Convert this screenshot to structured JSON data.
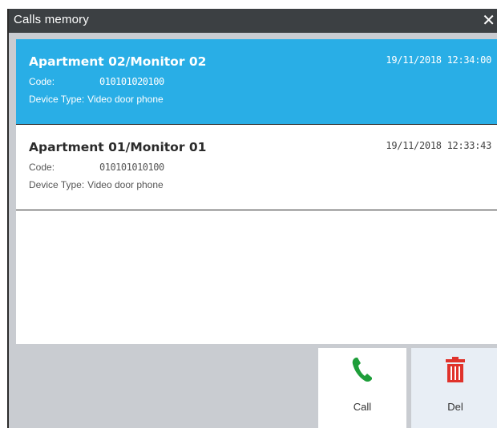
{
  "window": {
    "title": "Calls memory",
    "close_glyph": "✕"
  },
  "calls": [
    {
      "name": "Apartment 02/Monitor 02",
      "datetime": "19/11/2018 12:34:00",
      "code_label": "Code:",
      "code": "010101020100",
      "device_type_label": "Device Type:",
      "device_type": "Video door phone",
      "selected": true
    },
    {
      "name": "Apartment 01/Monitor 01",
      "datetime": "19/11/2018 12:33:43",
      "code_label": "Code:",
      "code": "010101010100",
      "device_type_label": "Device Type:",
      "device_type": "Video door phone",
      "selected": false
    }
  ],
  "actions": {
    "call_label": "Call",
    "call_icon": "phone-icon",
    "call_icon_color": "#1e9e3a",
    "del_label": "Del",
    "del_icon": "trash-icon",
    "del_icon_color": "#e0322b"
  },
  "colors": {
    "selected_bg": "#29aee6",
    "titlebar_bg": "#3c4043",
    "window_bg": "#c9ccd1"
  }
}
